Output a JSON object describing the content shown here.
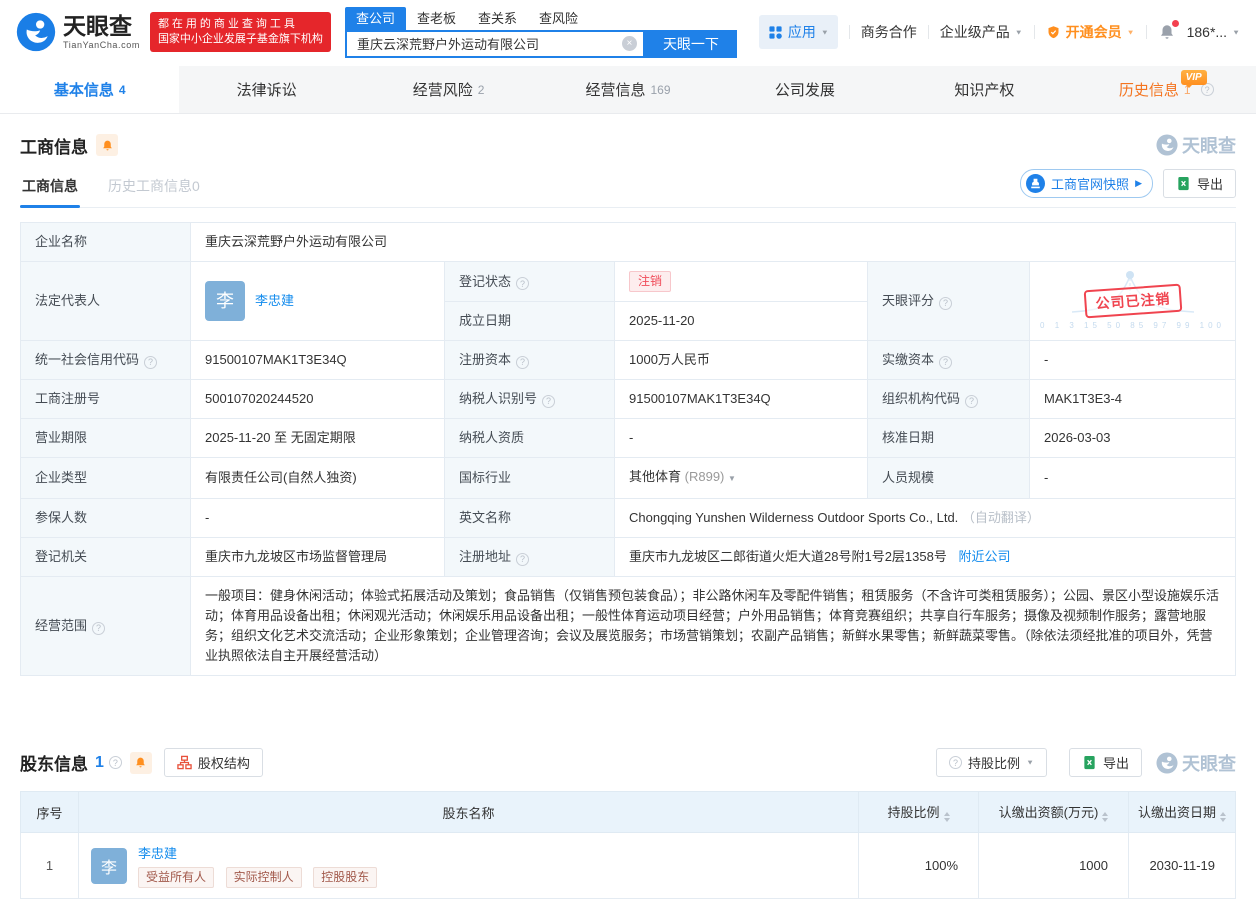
{
  "brand": {
    "name": "天眼查",
    "domain": "TianYanCha.com",
    "promo_line1": "都在用的商业查询工具",
    "promo_line2": "国家中小企业发展子基金旗下机构"
  },
  "icons": {
    "help": "?",
    "clear": "×",
    "caret": "▼",
    "arrow_right": "▶"
  },
  "search": {
    "tabs": [
      "查公司",
      "查老板",
      "查关系",
      "查风险"
    ],
    "query": "重庆云深荒野户外运动有限公司",
    "button_label": "天眼一下"
  },
  "top_nav": {
    "apps": "应用",
    "cooperation": "商务合作",
    "enterprise": "企业级产品",
    "membership": "开通会员",
    "user": "186*..."
  },
  "main_tabs": [
    {
      "label": "基本信息",
      "count": "4"
    },
    {
      "label": "法律诉讼",
      "count": ""
    },
    {
      "label": "经营风险",
      "count": "2"
    },
    {
      "label": "经营信息",
      "count": "169"
    },
    {
      "label": "公司发展",
      "count": ""
    },
    {
      "label": "知识产权",
      "count": ""
    },
    {
      "label": "历史信息",
      "count": "1"
    }
  ],
  "vip_badge": "VIP",
  "biz_section": {
    "title": "工商信息",
    "tab_current": "工商信息",
    "tab_history": "历史工商信息0",
    "snapshot_button": "工商官网快照",
    "export_button": "导出",
    "watermark": "天眼查"
  },
  "biz": {
    "company_name_label": "企业名称",
    "company_name": "重庆云深荒野户外运动有限公司",
    "legal_rep_label": "法定代表人",
    "legal_rep_avatar": "李",
    "legal_rep_name": "李忠建",
    "reg_status_label": "登记状态",
    "reg_status": "注销",
    "est_date_label": "成立日期",
    "est_date": "2025-11-20",
    "score_label": "天眼评分",
    "score_stamp": "公司已注销",
    "score_axis": "0 1 3 15 50 85 97 99 100",
    "credit_code_label": "统一社会信用代码",
    "credit_code": "91500107MAK1T3E34Q",
    "reg_capital_label": "注册资本",
    "reg_capital": "1000万人民币",
    "paid_capital_label": "实缴资本",
    "paid_capital": "-",
    "reg_number_label": "工商注册号",
    "reg_number": "500107020244520",
    "taxpayer_id_label": "纳税人识别号",
    "taxpayer_id": "91500107MAK1T3E34Q",
    "org_code_label": "组织机构代码",
    "org_code": "MAK1T3E3-4",
    "biz_term_label": "营业期限",
    "biz_term": "2025-11-20 至 无固定期限",
    "taxpayer_qual_label": "纳税人资质",
    "taxpayer_qual": "-",
    "approve_date_label": "核准日期",
    "approve_date": "2026-03-03",
    "company_type_label": "企业类型",
    "company_type": "有限责任公司(自然人独资)",
    "industry_label": "国标行业",
    "industry": "其他体育",
    "industry_code": "(R899)",
    "staff_size_label": "人员规模",
    "staff_size": "-",
    "insured_label": "参保人数",
    "insured": "-",
    "english_name_label": "英文名称",
    "english_name": "Chongqing Yunshen Wilderness Outdoor Sports Co., Ltd.",
    "english_name_note": "（自动翻译）",
    "reg_authority_label": "登记机关",
    "reg_authority": "重庆市九龙坡区市场监督管理局",
    "address_label": "注册地址",
    "address": "重庆市九龙坡区二郎街道火炬大道28号附1号2层1358号",
    "address_link": "附近公司",
    "scope_label": "经营范围",
    "scope": "一般项目：健身休闲活动；体验式拓展活动及策划；食品销售（仅销售预包装食品）；非公路休闲车及零配件销售；租赁服务（不含许可类租赁服务）；公园、景区小型设施娱乐活动；体育用品设备出租；休闲观光活动；休闲娱乐用品设备出租；一般性体育运动项目经营；户外用品销售；体育竞赛组织；共享自行车服务；摄像及视频制作服务；露营地服务；组织文化艺术交流活动；企业形象策划；企业管理咨询；会议及展览服务；市场营销策划；农副产品销售；新鲜水果零售；新鲜蔬菜零售。（除依法须经批准的项目外，凭营业执照依法自主开展经营活动）"
  },
  "holders": {
    "title": "股东信息",
    "count": "1",
    "equity_button": "股权结构",
    "ratio_button": "持股比例",
    "export_button": "导出",
    "watermark": "天眼查",
    "headers": [
      "序号",
      "股东名称",
      "持股比例",
      "认缴出资额(万元)",
      "认缴出资日期"
    ],
    "rows": [
      {
        "no": "1",
        "avatar": "李",
        "name": "李忠建",
        "tags": [
          "受益所有人",
          "实际控制人",
          "控股股东"
        ],
        "ratio": "100%",
        "amount": "1000",
        "date": "2030-11-19"
      }
    ]
  },
  "colors": {
    "brand_blue": "#1f81e8",
    "link_blue": "#128bed",
    "promo_red": "#e5262b",
    "status_red": "#f0444f",
    "vip_orange": "#ff8f1f"
  }
}
